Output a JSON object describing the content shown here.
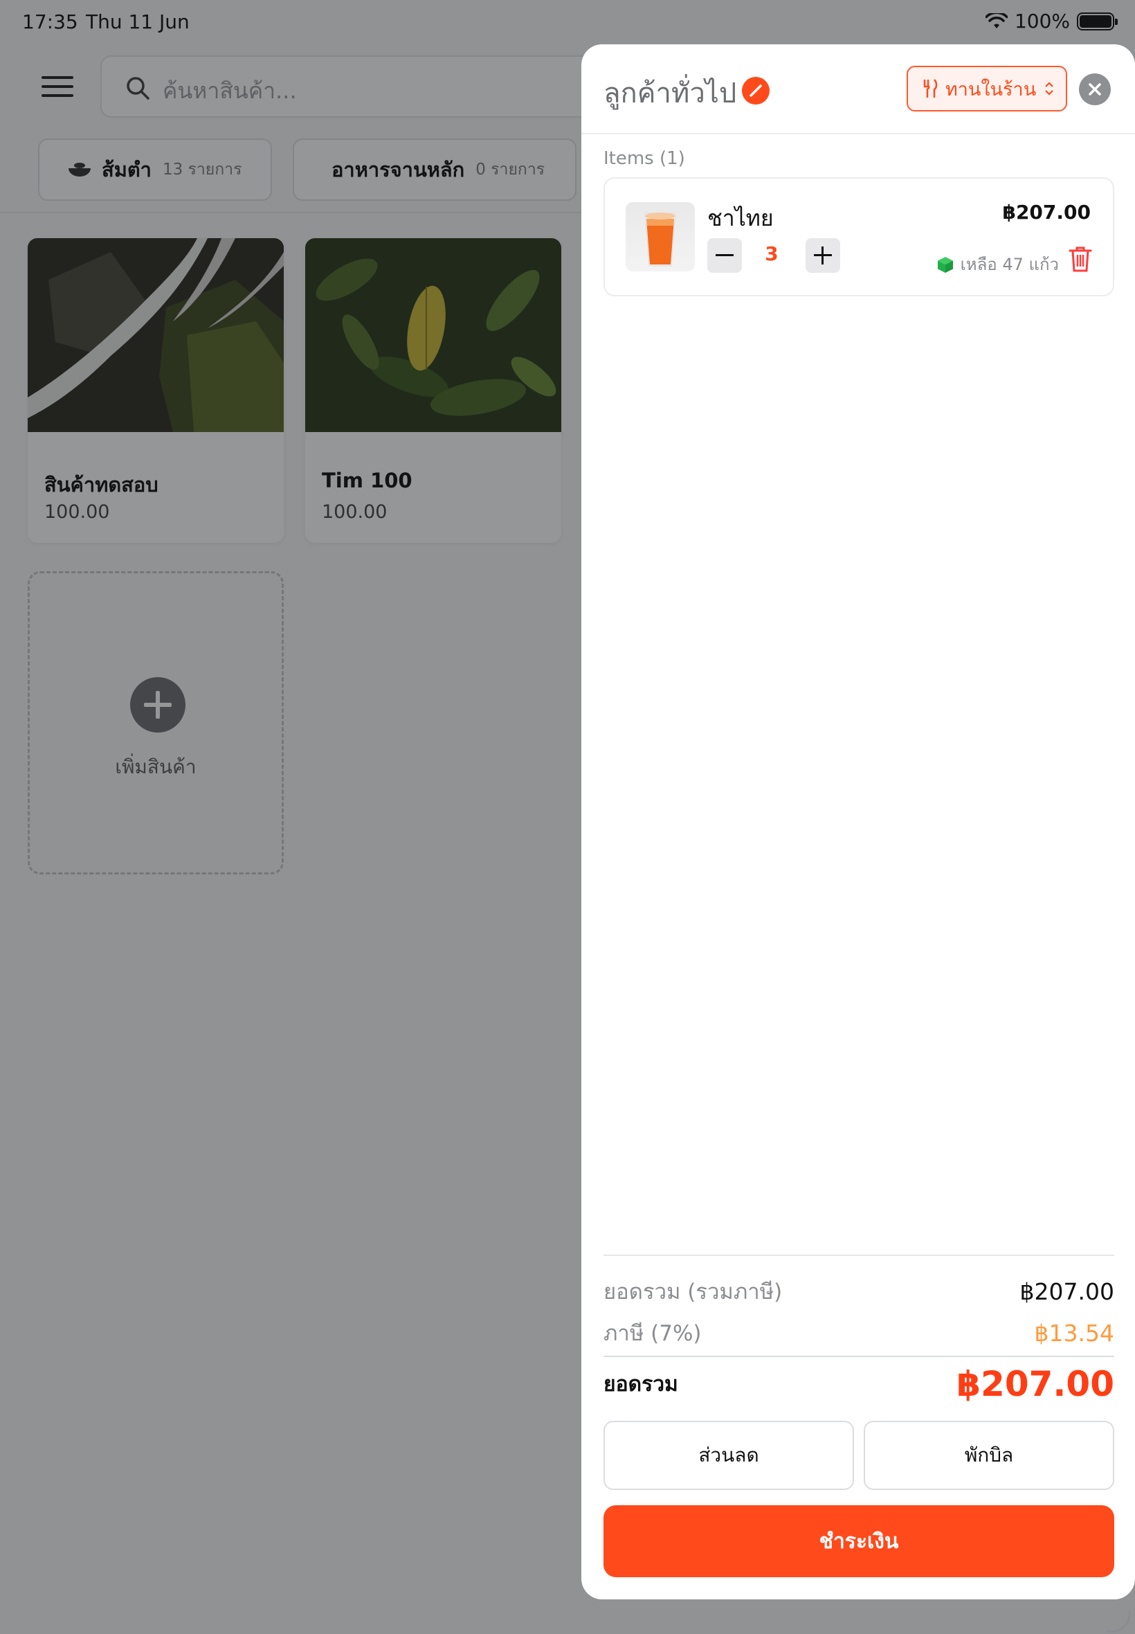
{
  "status_bar": {
    "time": "17:35",
    "date": "Thu 11 Jun",
    "battery": "100%"
  },
  "search": {
    "placeholder": "ค้นหาสินค้า..."
  },
  "categories": [
    {
      "name": "ส้มตำ",
      "count": "13 รายการ"
    },
    {
      "name": "อาหารจานหลัก",
      "count": "0 รายการ"
    }
  ],
  "products": [
    {
      "name": "สินค้าทดสอบ",
      "price": "100.00"
    },
    {
      "name": "Tim 100",
      "price": "100.00"
    }
  ],
  "add_product_label": "เพิ่มสินค้า",
  "cart": {
    "customer": "ลูกค้าทั่วไป",
    "order_type": "ทานในร้าน",
    "items_label": "Items (1)",
    "items": [
      {
        "name": "ชาไทย",
        "price": "฿207.00",
        "quantity": "3",
        "stock": "เหลือ 47 แก้ว"
      }
    ],
    "subtotal_label": "ยอดรวม (รวมภาษี)",
    "subtotal_value": "฿207.00",
    "tax_label": "ภาษี (7%)",
    "tax_value": "฿13.54",
    "total_label": "ยอดรวม",
    "total_value": "฿207.00",
    "discount_button": "ส่วนลด",
    "hold_button": "พักบิล",
    "pay_button": "ชำระเงิน"
  },
  "colors": {
    "accent": "#ff4a1c",
    "tax": "#ff9a3c",
    "stock_icon": "#22b04b",
    "overlay": "rgba(20,22,25,0.45)"
  }
}
